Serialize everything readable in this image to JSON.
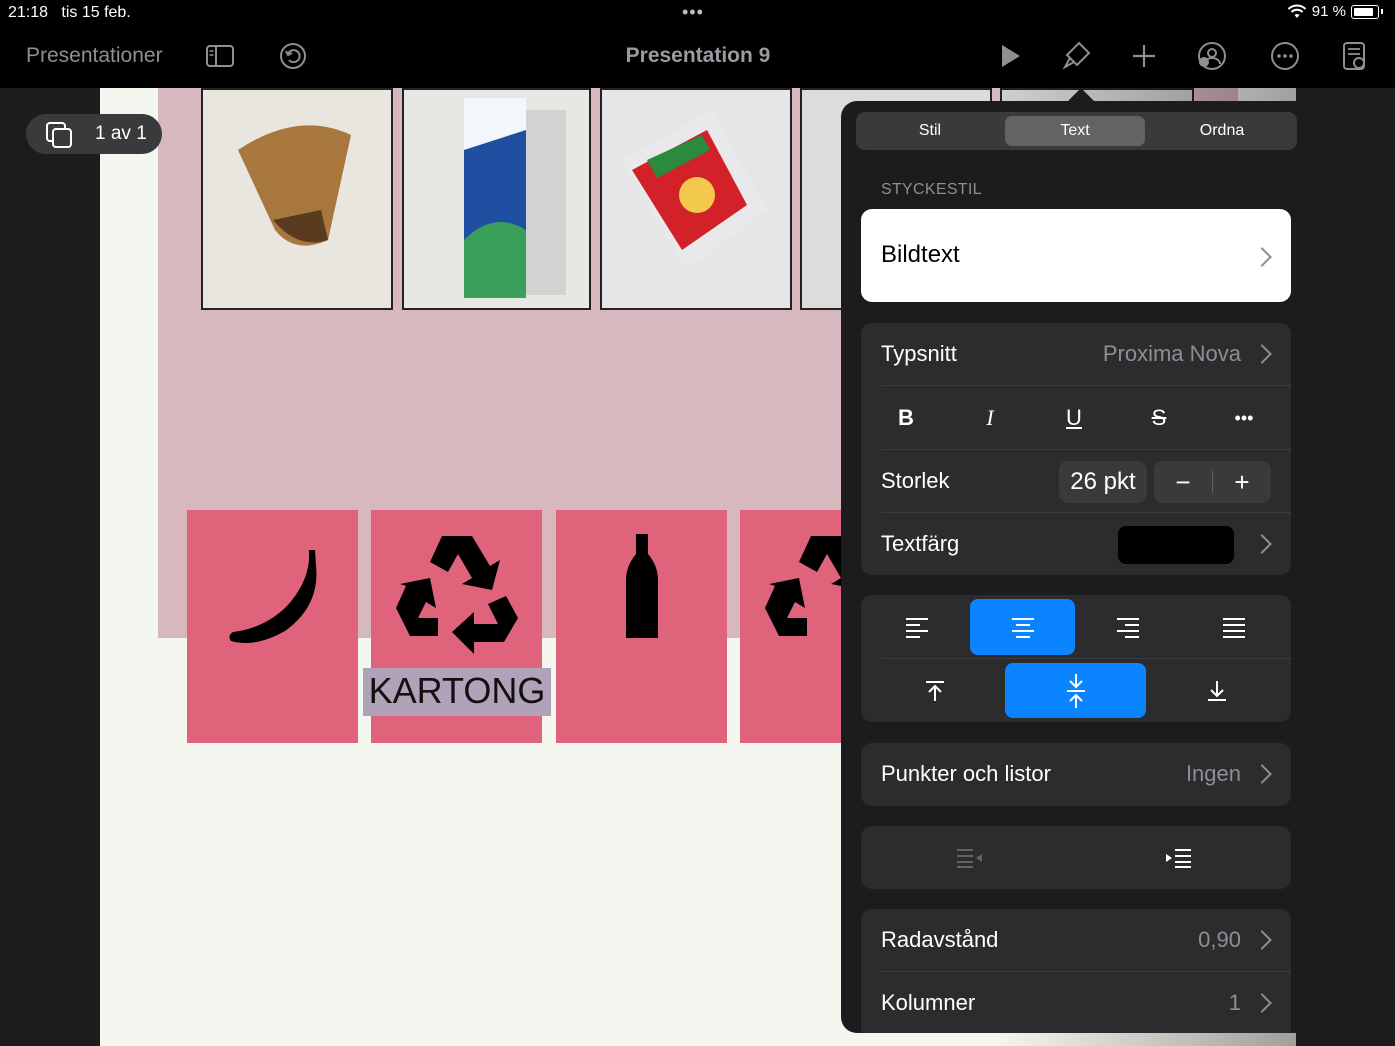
{
  "status": {
    "time": "21:18",
    "date": "tis 15 feb.",
    "battery": "91 %",
    "multitask_dots": "•••"
  },
  "toolbar": {
    "back_label": "Presentationer",
    "title": "Presentation 9",
    "icons": [
      "sidebar-icon",
      "undo-icon",
      "play-icon",
      "format-brush-icon",
      "add-icon",
      "collaborate-icon",
      "more-icon",
      "document-icon"
    ]
  },
  "slide_counter": {
    "label": "1 av 1"
  },
  "slide": {
    "caption": "KARTONG",
    "tiles": [
      "banana-icon",
      "recycle-icon",
      "bottle-icon",
      "recycle-icon"
    ],
    "photos": [
      "coffee-filter-photo",
      "milk-carton-photo",
      "pasta-package-photo",
      "photo-4",
      "photo-5"
    ],
    "colors": {
      "pink_background": "#d7b8bf",
      "tile": "#df637a",
      "selection": "#b2a2b9"
    }
  },
  "popover": {
    "tabs": [
      {
        "label": "Stil",
        "selected": false
      },
      {
        "label": "Text",
        "selected": true
      },
      {
        "label": "Ordna",
        "selected": false
      }
    ],
    "paragraph_style_heading": "STYCKESTIL",
    "paragraph_style": "Bildtext",
    "font_label": "Typsnitt",
    "font_value": "Proxima Nova",
    "format_buttons": {
      "bold": "B",
      "italic": "I",
      "underline": "U",
      "strikethrough": "S",
      "more": "•••"
    },
    "size_label": "Storlek",
    "size_value": "26 pkt",
    "stepper": {
      "minus": "−",
      "plus": "+"
    },
    "text_color_label": "Textfärg",
    "text_color": "#000000",
    "horizontal_alignment": "center",
    "vertical_alignment": "middle",
    "bullets_label": "Punkter och listor",
    "bullets_value": "Ingen",
    "line_spacing_label": "Radavstånd",
    "line_spacing_value": "0,90",
    "columns_label": "Kolumner",
    "columns_value": "1",
    "accent": "#0a84ff"
  }
}
